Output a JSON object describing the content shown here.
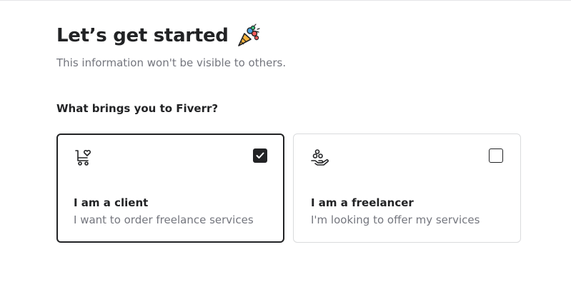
{
  "header": {
    "title": "Let’s get started",
    "subtitle": "This information won't be visible to others."
  },
  "question": "What brings you to Fiverr?",
  "options": [
    {
      "title": "I am a client",
      "description": "I want to order freelance services",
      "icon": "shopping-cart-heart-icon",
      "selected": true
    },
    {
      "title": "I am a freelancer",
      "description": "I'm looking to offer my services",
      "icon": "hand-with-coins-icon",
      "selected": false
    }
  ],
  "colors": {
    "text": "#222325",
    "muted": "#74767e",
    "border": "#dadbdd",
    "selected_border": "#222325"
  }
}
